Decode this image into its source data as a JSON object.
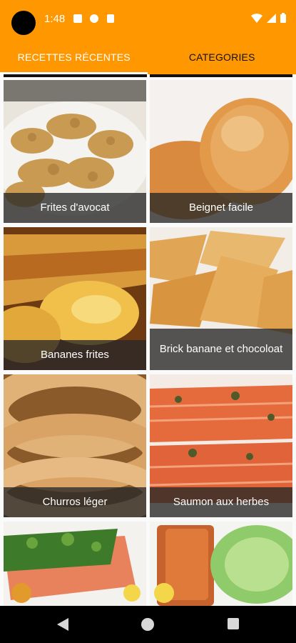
{
  "status_bar": {
    "time": "1:48"
  },
  "tabs": [
    {
      "label": "RECETTES RÉCENTES",
      "selected": true
    },
    {
      "label": "CATEGORIES",
      "selected": false
    }
  ],
  "colors": {
    "accent": "#ff9800",
    "caption_bg": "#2b2b2b",
    "nav_bg": "#000000"
  },
  "recipes": [
    {
      "name": "Frites d'avocat"
    },
    {
      "name": "Beignet facile"
    },
    {
      "name": "Bananes frites"
    },
    {
      "name": "Brick banane et chocoloat"
    },
    {
      "name": "Churros léger"
    },
    {
      "name": "Saumon aux herbes"
    }
  ]
}
